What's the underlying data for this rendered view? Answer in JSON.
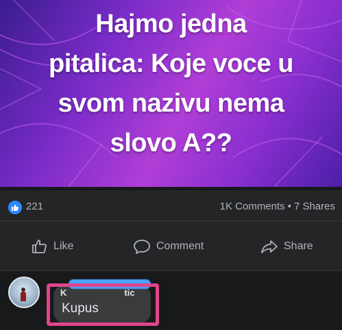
{
  "post": {
    "headline_lines": [
      "Hajmo jedna",
      "pitalica: Koje voce u",
      "svom nazivu nema",
      "slovo A??"
    ]
  },
  "stats": {
    "like_icon": "thumbs-up-icon",
    "like_count": "221",
    "comments": "1K Comments",
    "separator": "•",
    "shares": "7 Shares"
  },
  "actions": {
    "like_label": "Like",
    "comment_label": "Comment",
    "share_label": "Share"
  },
  "comment": {
    "author_fragment": "K",
    "author_suffix": "tic",
    "text": "Kupus"
  },
  "colors": {
    "accent_blue": "#2d88ff",
    "highlight_pink": "#e0458a",
    "background": "#18191a",
    "card": "#242526"
  }
}
